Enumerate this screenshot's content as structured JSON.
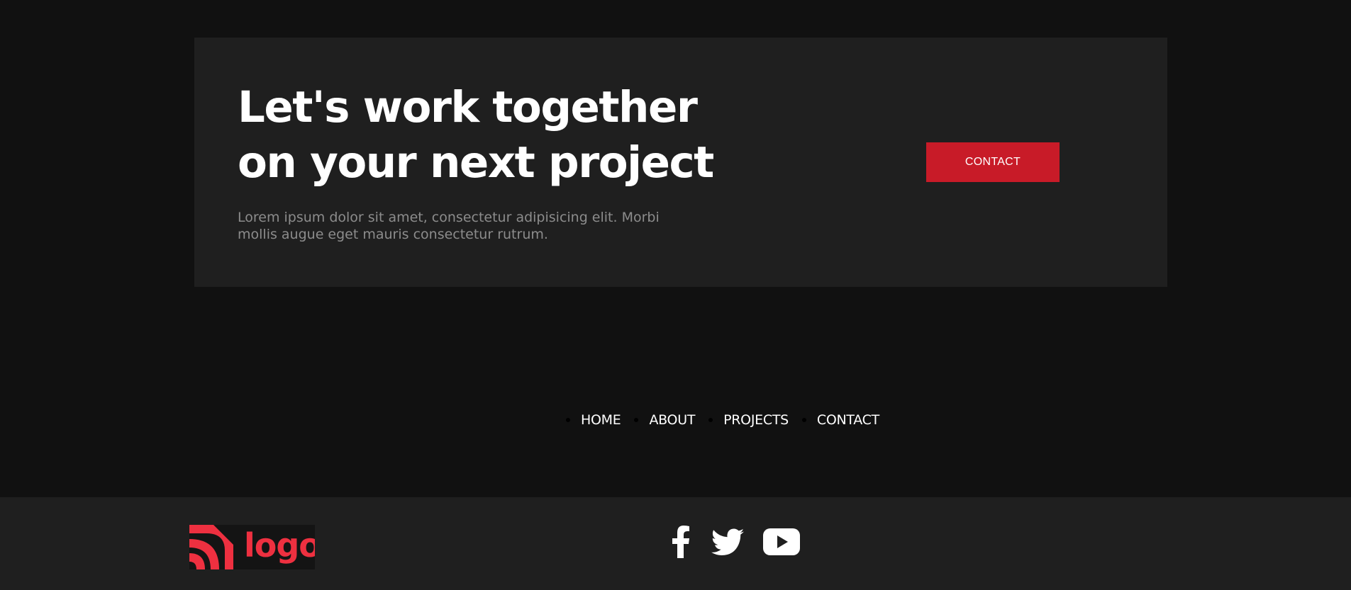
{
  "cta": {
    "title_line1": "Let's work together",
    "title_line2": "on your next project",
    "text_line1": "Lorem ipsum dolor sit amet, consectetur adipisicing elit. Morbi",
    "text_line2": "mollis augue eget mauris consectetur rutrum.",
    "button_label": "CONTACT",
    "button_color": "#c81b28"
  },
  "nav": {
    "items": [
      {
        "label": "HOME"
      },
      {
        "label": "ABOUT"
      },
      {
        "label": "PROJECTS"
      },
      {
        "label": "CONTACT"
      }
    ]
  },
  "footer": {
    "logo_text": "logo",
    "logo_color": "#ee3040",
    "social_icons": [
      "facebook-icon",
      "twitter-icon",
      "youtube-icon"
    ]
  }
}
